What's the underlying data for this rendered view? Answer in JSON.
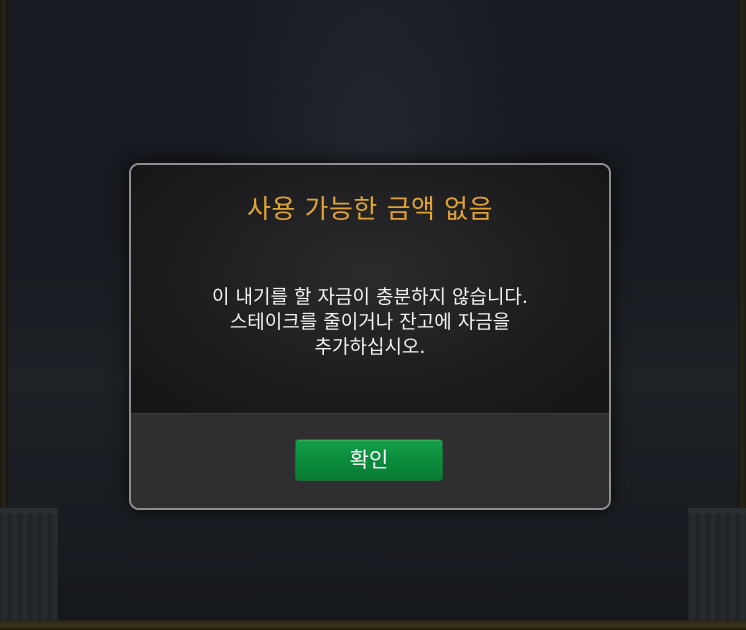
{
  "dialog": {
    "title": "사용 가능한 금액 없음",
    "message_lines": [
      "이 내기를 할 자금이 충분하지 않습니다.",
      "스테이크를 줄이거나 잔고에 자금을",
      "추가하십시오."
    ],
    "confirm_label": "확인"
  },
  "colors": {
    "title": "#e0a435",
    "button": "#0b8a3c",
    "dialog_border": "#8d8e90"
  }
}
